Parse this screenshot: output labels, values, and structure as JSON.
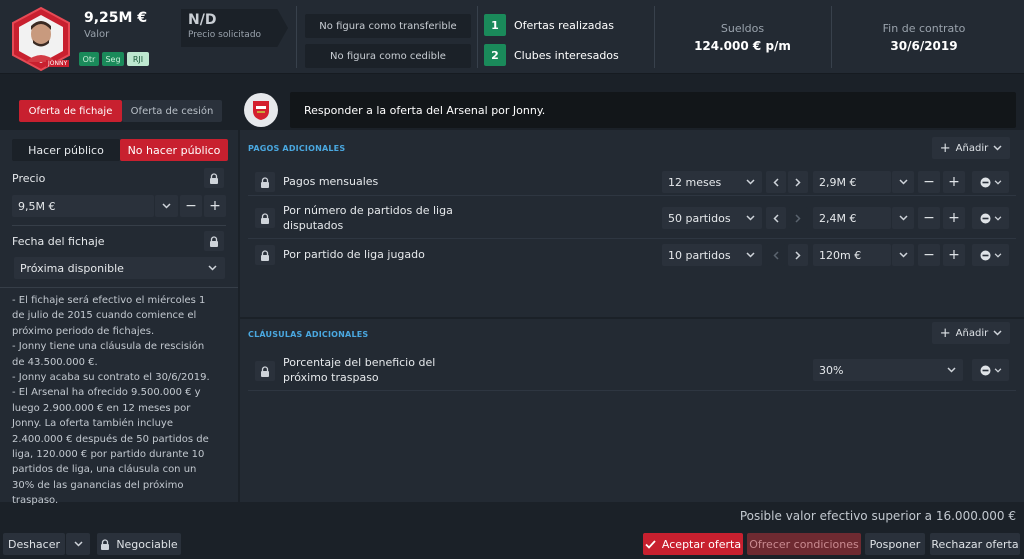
{
  "player": {
    "value": "9,25M €",
    "value_label": "Valor",
    "asking_price": "N/D",
    "asking_price_label": "Precio solicitado",
    "badges": [
      "Otr",
      "Seg",
      "RJI"
    ],
    "name_tag": "JONNY"
  },
  "status": {
    "transferible": "No figura como transferible",
    "cedible": "No figura como cedible"
  },
  "offers": [
    {
      "count": "1",
      "label": "Ofertas realizadas"
    },
    {
      "count": "2",
      "label": "Clubes interesados"
    }
  ],
  "wages": {
    "label": "Sueldos",
    "value": "124.000 € p/m"
  },
  "contract": {
    "label": "Fin de contrato",
    "value": "30/6/2019"
  },
  "tabs": {
    "transfer": "Oferta de fichaje",
    "loan": "Oferta de cesión"
  },
  "message": "Responder a la oferta del Arsenal por Jonny.",
  "left": {
    "make_public": "Hacer público",
    "no_public": "No hacer público",
    "price_label": "Precio",
    "price_value": "9,5M €",
    "date_label": "Fecha del fichaje",
    "date_value": "Próxima disponible",
    "notes": [
      "- El fichaje será efectivo el miércoles 1 de julio de 2015 cuando comience el próximo periodo de fichajes.",
      "- Jonny tiene una cláusula de rescisión de 43.500.000 €.",
      "- Jonny acaba su contrato el 30/6/2019.",
      "- El Arsenal ha ofrecido 9.500.000 € y luego 2.900.000 € en 12 meses por Jonny. La oferta también incluye 2.400.000 € después de 50 partidos de liga, 120.000 € por partido durante 10 partidos de liga, una cláusula con un 30% de las ganancias del próximo traspaso."
    ]
  },
  "additional_payments": {
    "title": "PAGOS ADICIONALES",
    "add_label": "Añadir",
    "rows": [
      {
        "label": "Pagos mensuales",
        "period": "12 meses",
        "amount": "2,9M €"
      },
      {
        "label": "Por número de partidos de liga disputados",
        "period": "50 partidos",
        "amount": "2,4M €"
      },
      {
        "label": "Por partido de liga jugado",
        "period": "10 partidos",
        "amount": "120m €"
      }
    ]
  },
  "additional_clauses": {
    "title": "CLÁUSULAS ADICIONALES",
    "add_label": "Añadir",
    "rows": [
      {
        "label": "Porcentaje del beneficio del próximo traspaso",
        "value": "30%"
      }
    ]
  },
  "footer": {
    "possible_value": "Posible valor efectivo superior a 16.000.000 €",
    "undo": "Deshacer",
    "negotiable": "Negociable",
    "accept": "Aceptar oferta",
    "offer_terms": "Ofrecer condiciones",
    "postpone": "Posponer",
    "reject": "Rechazar oferta"
  },
  "colors": {
    "accent": "#c8202f",
    "green": "#1a8a5a",
    "link": "#4aa8e0"
  }
}
